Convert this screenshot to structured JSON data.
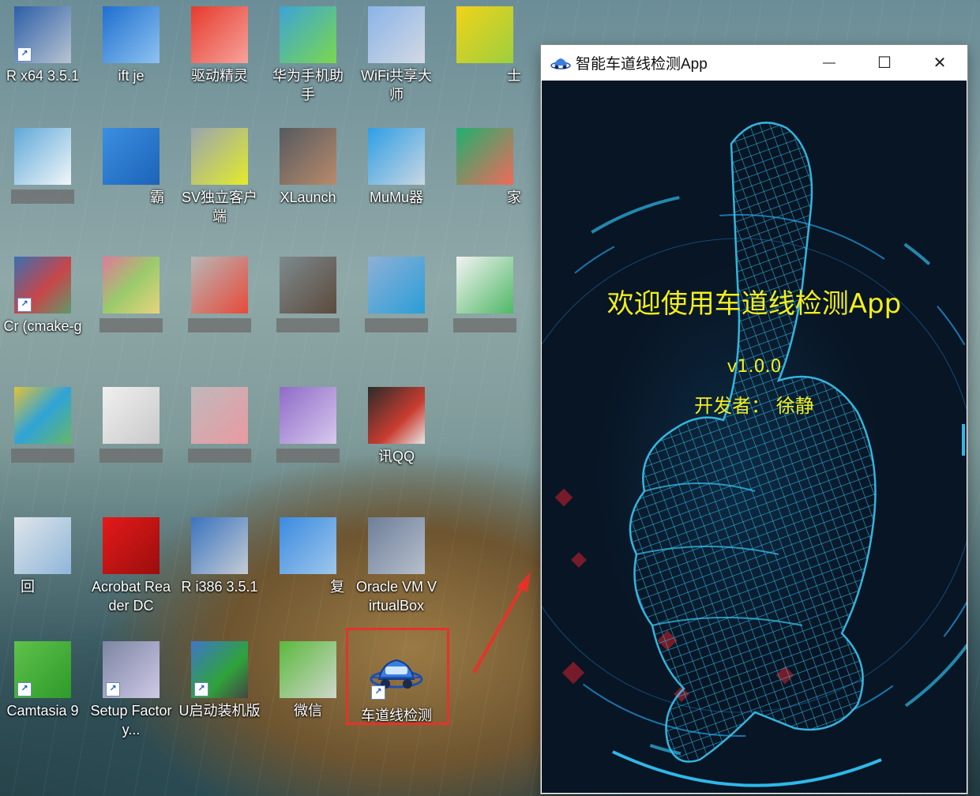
{
  "desktop": {
    "icons": [
      {
        "label": "R x64 3.5.1"
      },
      {
        "label": "ift je"
      },
      {
        "label": "驱动精灵"
      },
      {
        "label": "华为手机助手"
      },
      {
        "label": "WiFi共享大师"
      },
      {
        "label": "士"
      },
      {
        "label": ""
      },
      {
        "label": "霸"
      },
      {
        "label": "SV独立客户端"
      },
      {
        "label": "XLaunch"
      },
      {
        "label": "MuMu器"
      },
      {
        "label": "家"
      },
      {
        "label": "Cr (cmake-g"
      },
      {
        "label": ""
      },
      {
        "label": ""
      },
      {
        "label": ""
      },
      {
        "label": ""
      },
      {
        "label": ""
      },
      {
        "label": ""
      },
      {
        "label": ""
      },
      {
        "label": ""
      },
      {
        "label": ""
      },
      {
        "label": "讯QQ"
      },
      {
        "label": "回"
      },
      {
        "label": "Acrobat Reader DC"
      },
      {
        "label": "R i386 3.5.1"
      },
      {
        "label": "复"
      },
      {
        "label": "Oracle VM VirtualBox"
      },
      {
        "label": "Camtasia 9"
      },
      {
        "label": "Setup Factory..."
      },
      {
        "label": "U启动装机版"
      },
      {
        "label": "微信"
      },
      {
        "label": "车道线检测"
      }
    ]
  },
  "app_window": {
    "title": "智能车道线检测App",
    "minimize_label": "—",
    "maximize_label": "☐",
    "close_label": "✕",
    "welcome_text": "欢迎使用车道线检测App",
    "version": "v1.0.0",
    "developer": "开发者：  徐静"
  },
  "colors": {
    "highlight": "#e5332a",
    "splash_text": "#f2ee1e",
    "wireframe": "#2fb8e8"
  }
}
